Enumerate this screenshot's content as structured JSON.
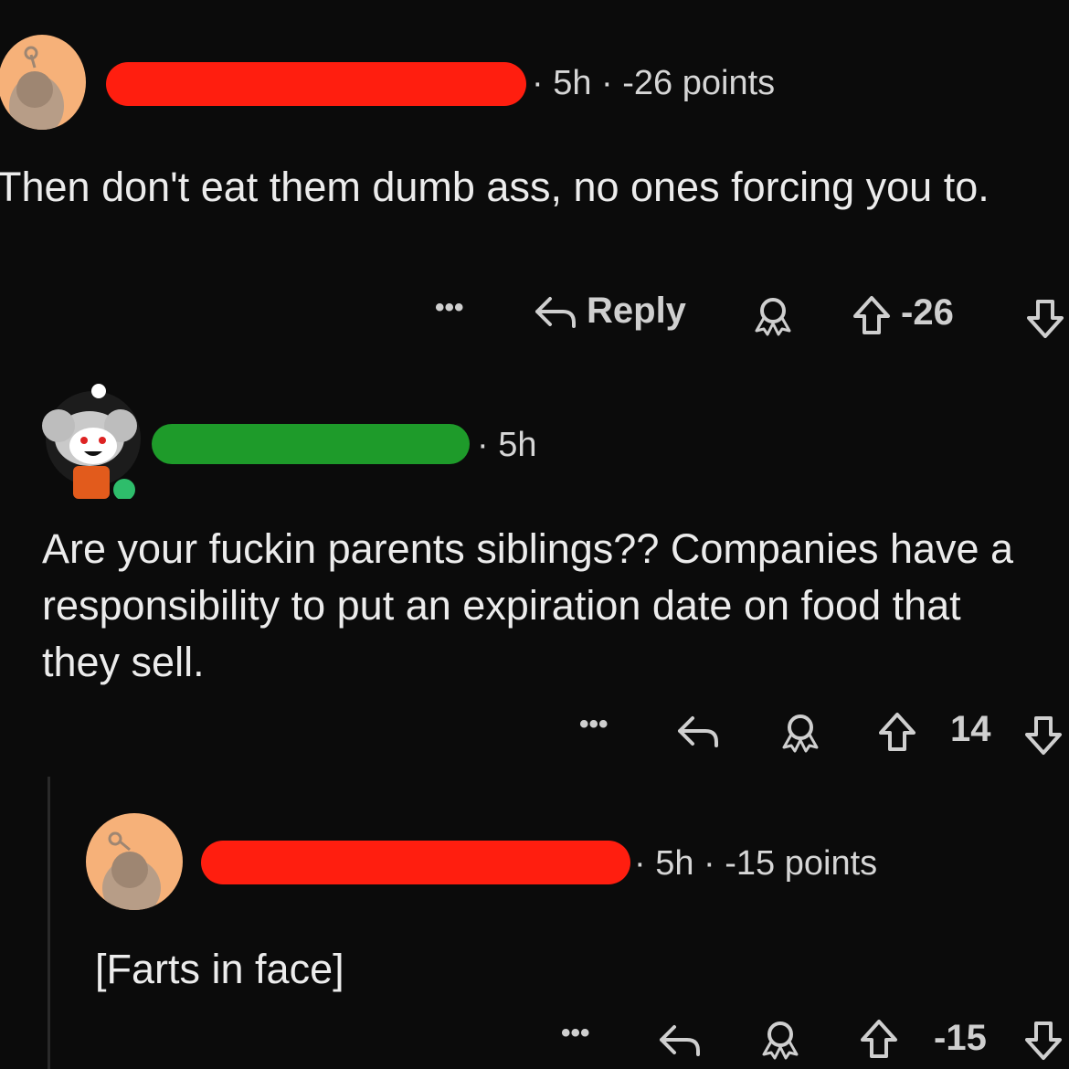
{
  "colors": {
    "background": "#0b0b0b",
    "redaction_red": "#ff1e0f",
    "redaction_green": "#1e9b2a",
    "avatar_orange": "#f6b179",
    "online_dot": "#2ebd6b"
  },
  "comments": [
    {
      "meta": "· 5h · -26 points",
      "body": "Then don't eat them dumb ass, no ones forcing you to.",
      "actions": {
        "more": "•••",
        "reply": "Reply",
        "score": "-26"
      }
    },
    {
      "meta": "· 5h",
      "body": "Are your fuckin parents siblings?? Companies have a responsibility to put an expiration date on food that they sell.",
      "actions": {
        "more": "•••",
        "score": "14"
      }
    },
    {
      "meta": "· 5h · -15 points",
      "body": "[Farts in face]",
      "actions": {
        "more": "•••",
        "score": "-15"
      }
    }
  ],
  "icons": [
    "reply-arrow-icon",
    "award-icon",
    "upvote-icon",
    "downvote-icon",
    "more-icon"
  ]
}
